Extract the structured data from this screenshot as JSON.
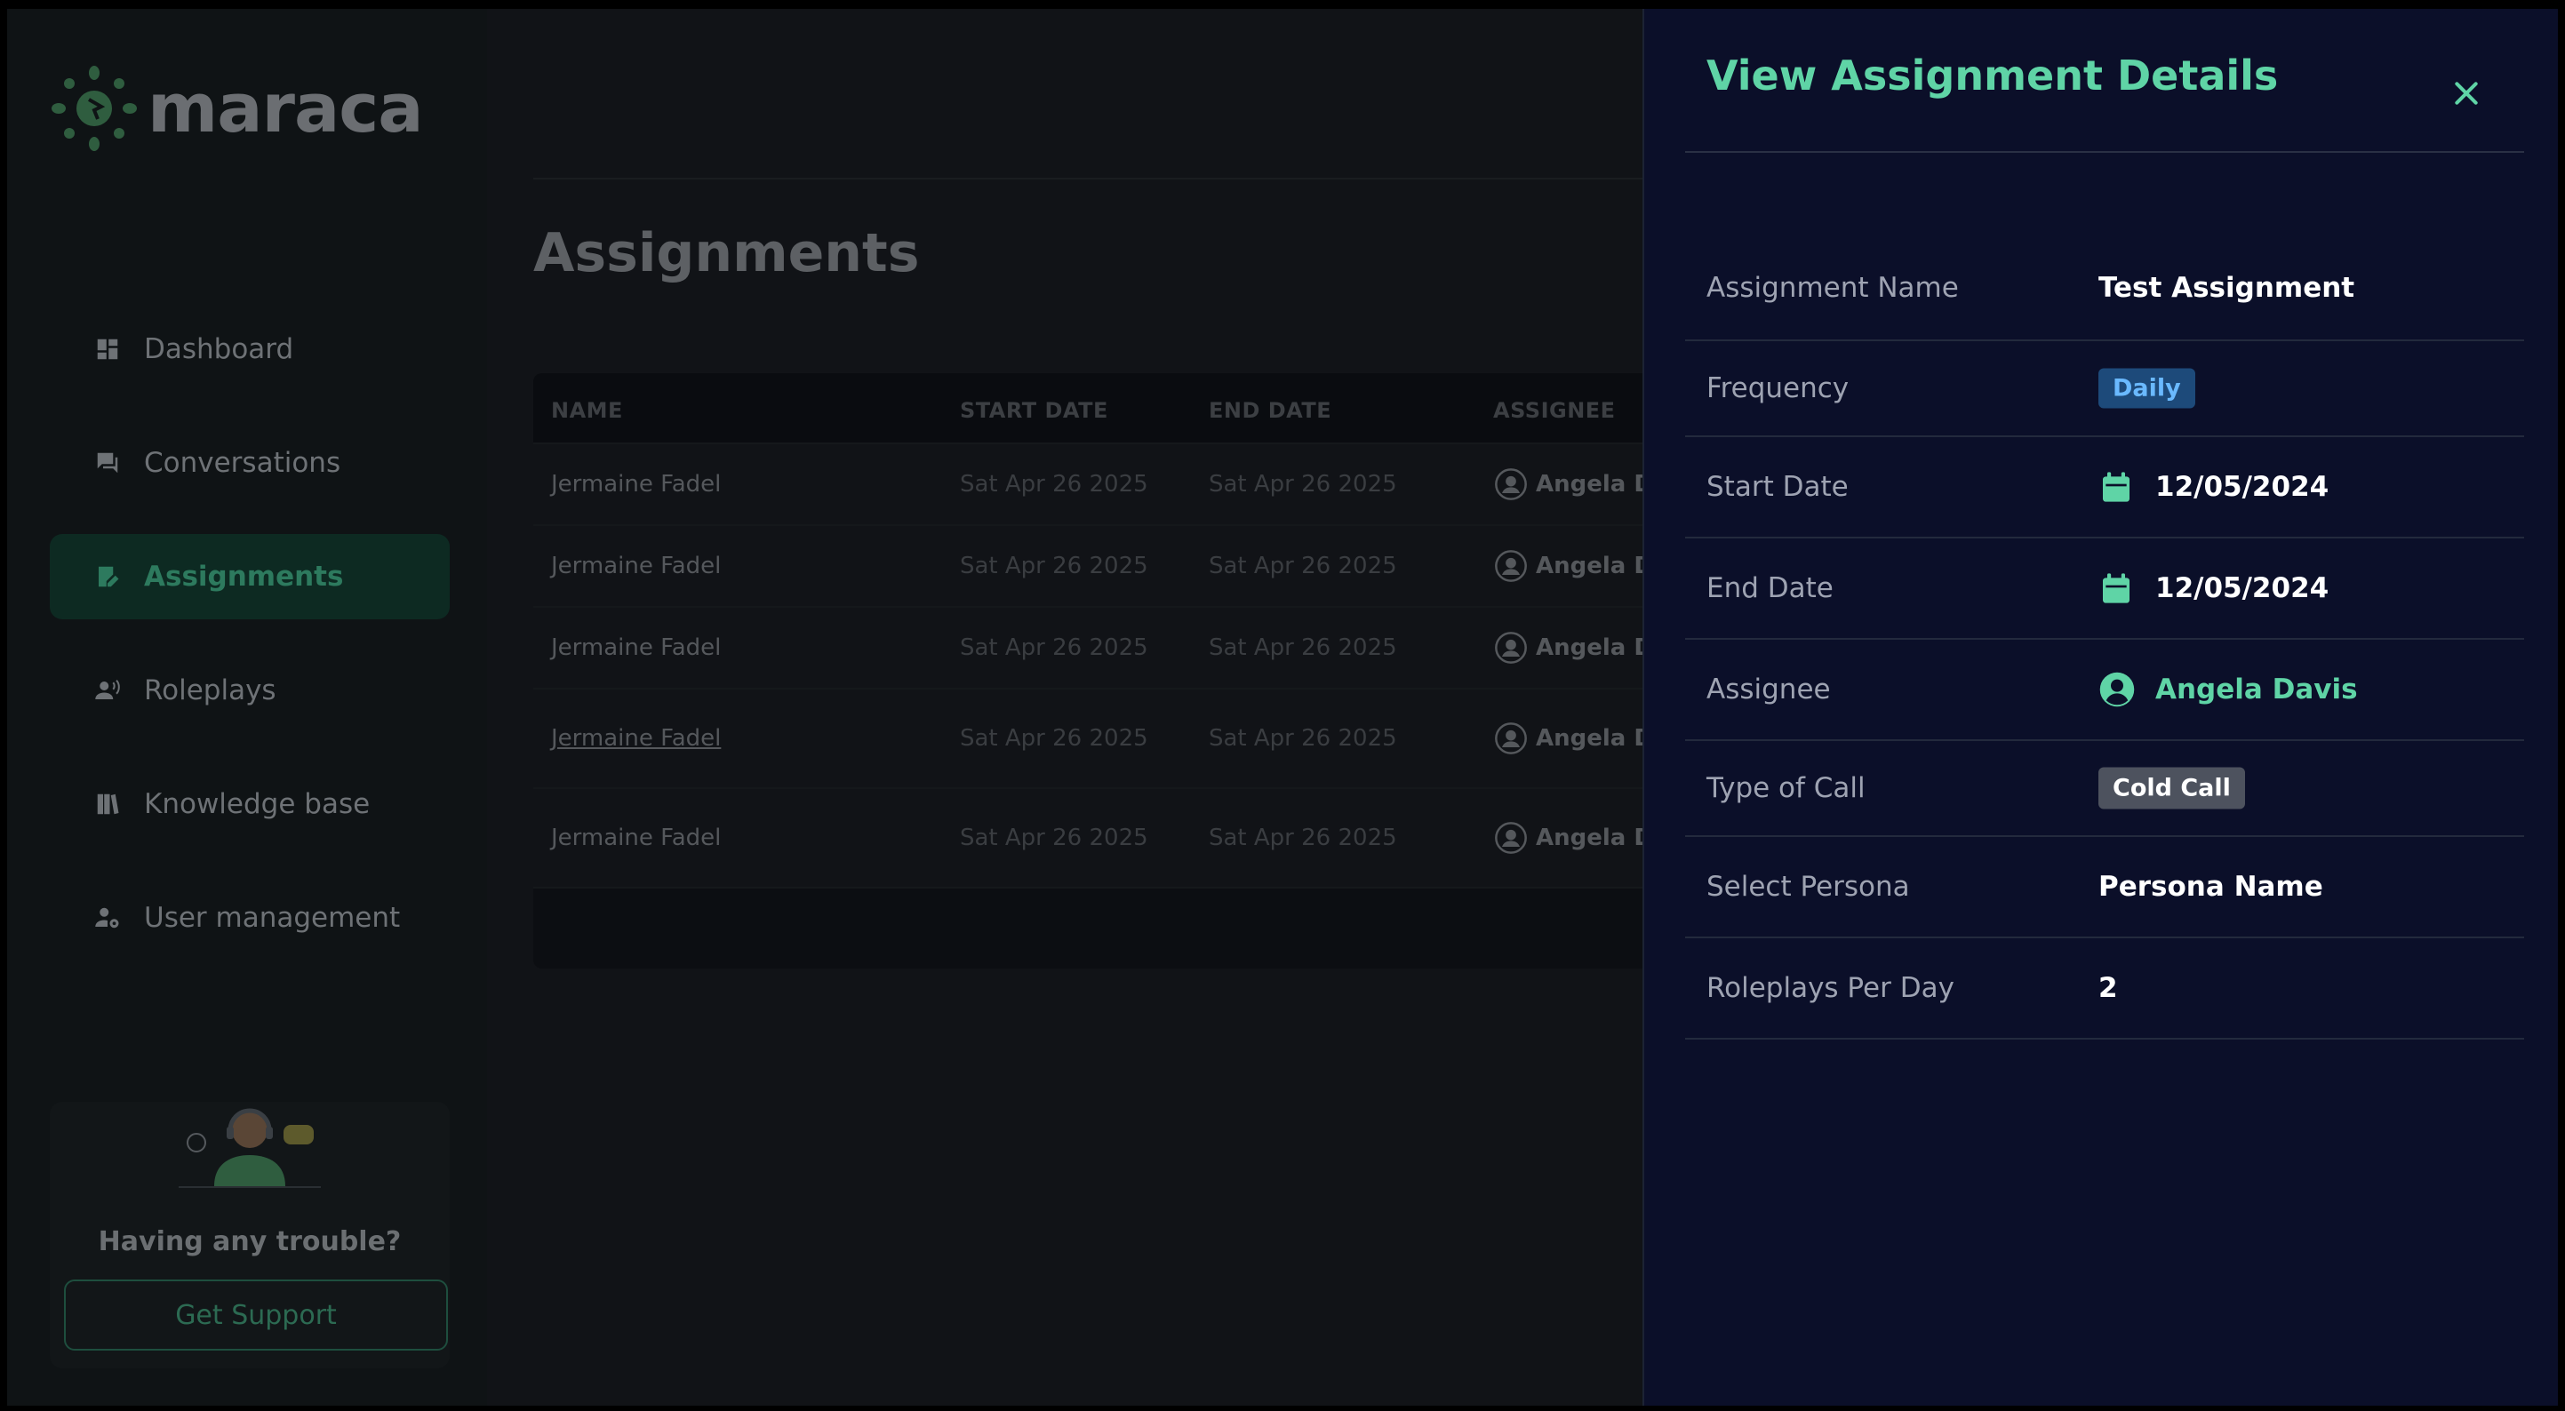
{
  "app": {
    "brand": "maraca"
  },
  "sidebar": {
    "items": [
      {
        "label": "Dashboard",
        "icon": "dashboard-icon"
      },
      {
        "label": "Conversations",
        "icon": "chat-icon"
      },
      {
        "label": "Assignments",
        "icon": "assignment-icon",
        "active": true
      },
      {
        "label": "Roleplays",
        "icon": "roleplay-icon"
      },
      {
        "label": "Knowledge base",
        "icon": "book-icon"
      },
      {
        "label": "User management",
        "icon": "user-settings-icon"
      }
    ],
    "support": {
      "title": "Having any trouble?",
      "button": "Get Support"
    }
  },
  "main": {
    "title": "Assignments",
    "table": {
      "headers": [
        "NAME",
        "START DATE",
        "END DATE",
        "ASSIGNEE"
      ],
      "rows": [
        {
          "name": "Jermaine Fadel",
          "start": "Sat Apr 26 2025",
          "end": "Sat Apr 26 2025",
          "assignee": "Angela D"
        },
        {
          "name": "Jermaine Fadel",
          "start": "Sat Apr 26 2025",
          "end": "Sat Apr 26 2025",
          "assignee": "Angela D"
        },
        {
          "name": "Jermaine Fadel",
          "start": "Sat Apr 26 2025",
          "end": "Sat Apr 26 2025",
          "assignee": "Angela D"
        },
        {
          "name": "Jermaine Fadel",
          "start": "Sat Apr 26 2025",
          "end": "Sat Apr 26 2025",
          "assignee": "Angela D"
        },
        {
          "name": "Jermaine Fadel",
          "start": "Sat Apr 26 2025",
          "end": "Sat Apr 26 2025",
          "assignee": "Angela D"
        }
      ]
    }
  },
  "drawer": {
    "title": "View Assignment Details",
    "details": {
      "assignment_name": {
        "label": "Assignment Name",
        "value": "Test Assignment"
      },
      "frequency": {
        "label": "Frequency",
        "value": "Daily"
      },
      "start_date": {
        "label": "Start Date",
        "value": "12/05/2024"
      },
      "end_date": {
        "label": "End Date",
        "value": "12/05/2024"
      },
      "assignee": {
        "label": "Assignee",
        "value": "Angela Davis"
      },
      "type_of_call": {
        "label": "Type of Call",
        "value": "Cold Call"
      },
      "persona": {
        "label": "Select Persona",
        "value": "Persona Name"
      },
      "roleplays_per_day": {
        "label": "Roleplays Per Day",
        "value": "2"
      }
    }
  },
  "colors": {
    "accent": "#5fd4a6",
    "drawer_bg": "#0b0f29",
    "badge_daily_bg": "#1d4a7a",
    "badge_call_bg": "#4d525e"
  }
}
